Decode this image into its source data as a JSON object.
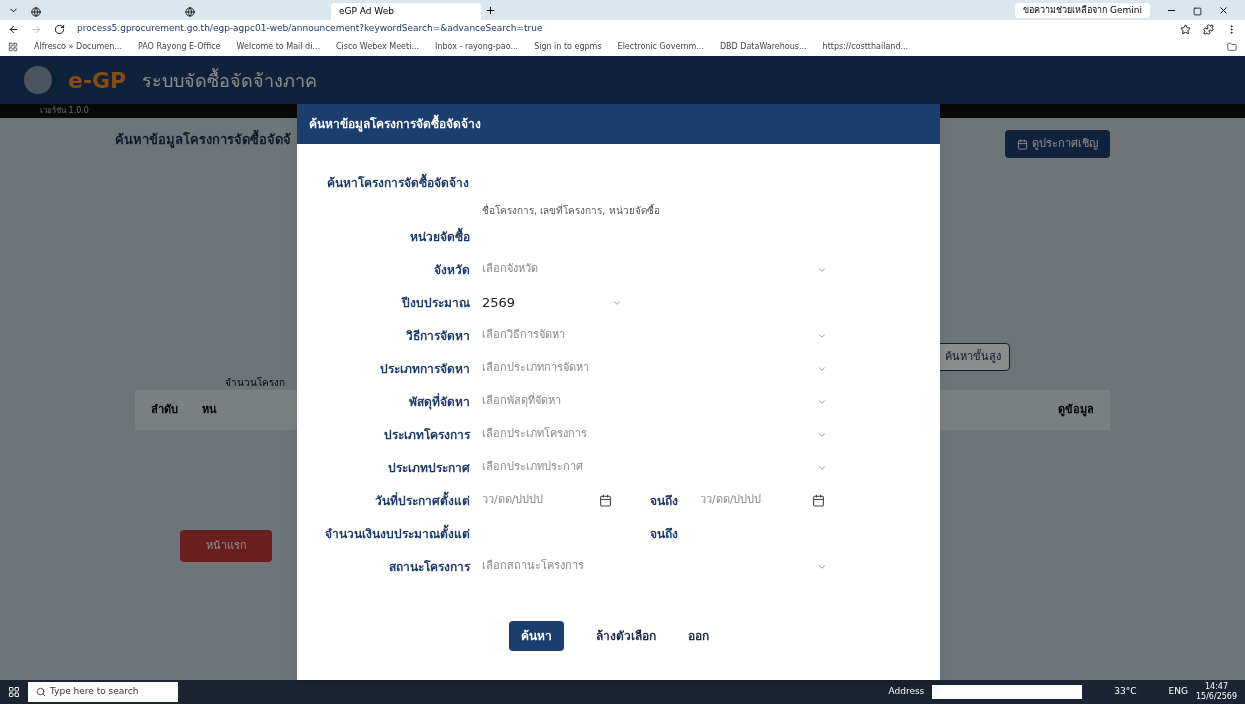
{
  "browser": {
    "tabs": [
      {
        "label": "eGP Ad Web",
        "selected": true
      }
    ],
    "gemini_button": "ขอความช่วยเหลือจาก Gemini",
    "address": "process5.gprocurement.go.th/egp-agpc01-web/announcement?keywordSearch=&advanceSearch=true",
    "bookmarks": [
      "Alfresco » Documen...",
      "PAO Rayong E-Office",
      "Welcome to Mail di...",
      "Cisco Webex Meeti...",
      "Inbox - rayong-pao...",
      "Sign in to egpms",
      "Electronic Governm...",
      "DBD DataWarehous...",
      "https://costthailand..."
    ]
  },
  "page": {
    "logo": "e-GP",
    "system_name": "ระบบจัดซื้อจัดจ้างภาค",
    "version": "เวอร์ชัน 1.0.0",
    "heading": "ค้นหาข้อมูลโครงการจัดซื้อจัดจ้",
    "announce_button": "ดูประกาศเชิญ",
    "advanced_button": "ค้นหาขั้นสูง",
    "count_label": "จำนวนโครงก",
    "columns": [
      "ลำดับ",
      "หน",
      "ดูข้อมูล"
    ],
    "home_button": "หน้าแรก"
  },
  "dialog": {
    "title": "ค้นหาข้อมูลโครงการจัดซื้อจัดจ้าง",
    "keyword": {
      "label": "ค้นหาโครงการจัดซื้อจัดจ้าง",
      "placeholder": "ชื่อโครงการ, เลขที่โครงการ, หน่วยจัดซื้อ"
    },
    "fields": [
      {
        "kind": "text",
        "label": "หน่วยจัดซื้อ"
      },
      {
        "kind": "select",
        "label": "จังหวัด",
        "placeholder": "เลือกจังหวัด"
      },
      {
        "kind": "year",
        "label": "ปีงบประมาณ",
        "value": "2569"
      },
      {
        "kind": "select",
        "label": "วิธีการจัดหา",
        "placeholder": "เลือกวิธีการจัดหา"
      },
      {
        "kind": "select",
        "label": "ประเภทการจัดหา",
        "placeholder": "เลือกประเภทการจัดหา"
      },
      {
        "kind": "select",
        "label": "พัสดุที่จัดหา",
        "placeholder": "เลือกพัสดุที่จัดหา"
      },
      {
        "kind": "select",
        "label": "ประเภทโครงการ",
        "placeholder": "เลือกประเภทโครงการ"
      },
      {
        "kind": "select",
        "label": "ประเภทประกาศ",
        "placeholder": "เลือกประเภทประกาศ"
      },
      {
        "kind": "date-range",
        "label": "วันที่ประกาศตั้งแต่",
        "placeholder": "วว/ดด/ปปปป",
        "to_label": "จนถึง",
        "to_placeholder": "วว/ดด/ปปปป"
      },
      {
        "kind": "number-range",
        "label": "จำนวนเงินงบประมาณตั้งแต่",
        "to_label": "จนถึง"
      },
      {
        "kind": "select",
        "label": "สถานะโครงการ",
        "placeholder": "เลือกสถานะโครงการ"
      }
    ],
    "buttons": [
      {
        "kind": "primary",
        "label": "ค้นหา"
      },
      {
        "kind": "plain",
        "label": "ล้างตัวเลือก"
      },
      {
        "kind": "plain",
        "label": "ออก"
      }
    ]
  },
  "taskbar": {
    "search_placeholder": "Type here to search",
    "address_label": "Address",
    "weather": "33°C",
    "language": "ENG",
    "time": "14:47",
    "date": "15/6/2569"
  }
}
